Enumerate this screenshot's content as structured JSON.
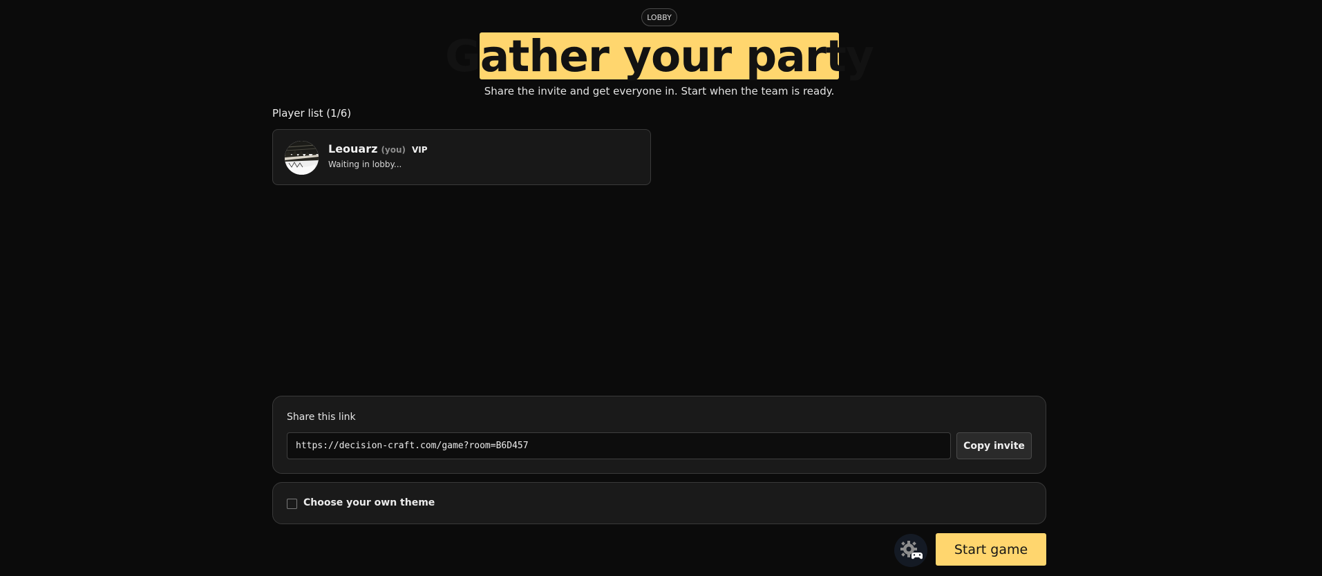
{
  "header": {
    "badge": "LOBBY",
    "title": "Gather your party",
    "subtitle": "Share the invite and get everyone in. Start when the team is ready."
  },
  "players": {
    "label": "Player list (1/6)",
    "items": [
      {
        "name": "Leouarz",
        "you_tag": "(you)",
        "role": "VIP",
        "status": "Waiting in lobby..."
      }
    ]
  },
  "share": {
    "label": "Share this link",
    "link": "https://decision-craft.com/game?room=B6D457",
    "copy_label": "Copy invite"
  },
  "theme": {
    "label": "Choose your own theme",
    "checked": false
  },
  "actions": {
    "start_label": "Start game",
    "settings_icon": "gear-gamepad-icon"
  },
  "colors": {
    "accent": "#ffd66e",
    "background": "#0b0b0b",
    "panel": "#1a1a1a"
  }
}
